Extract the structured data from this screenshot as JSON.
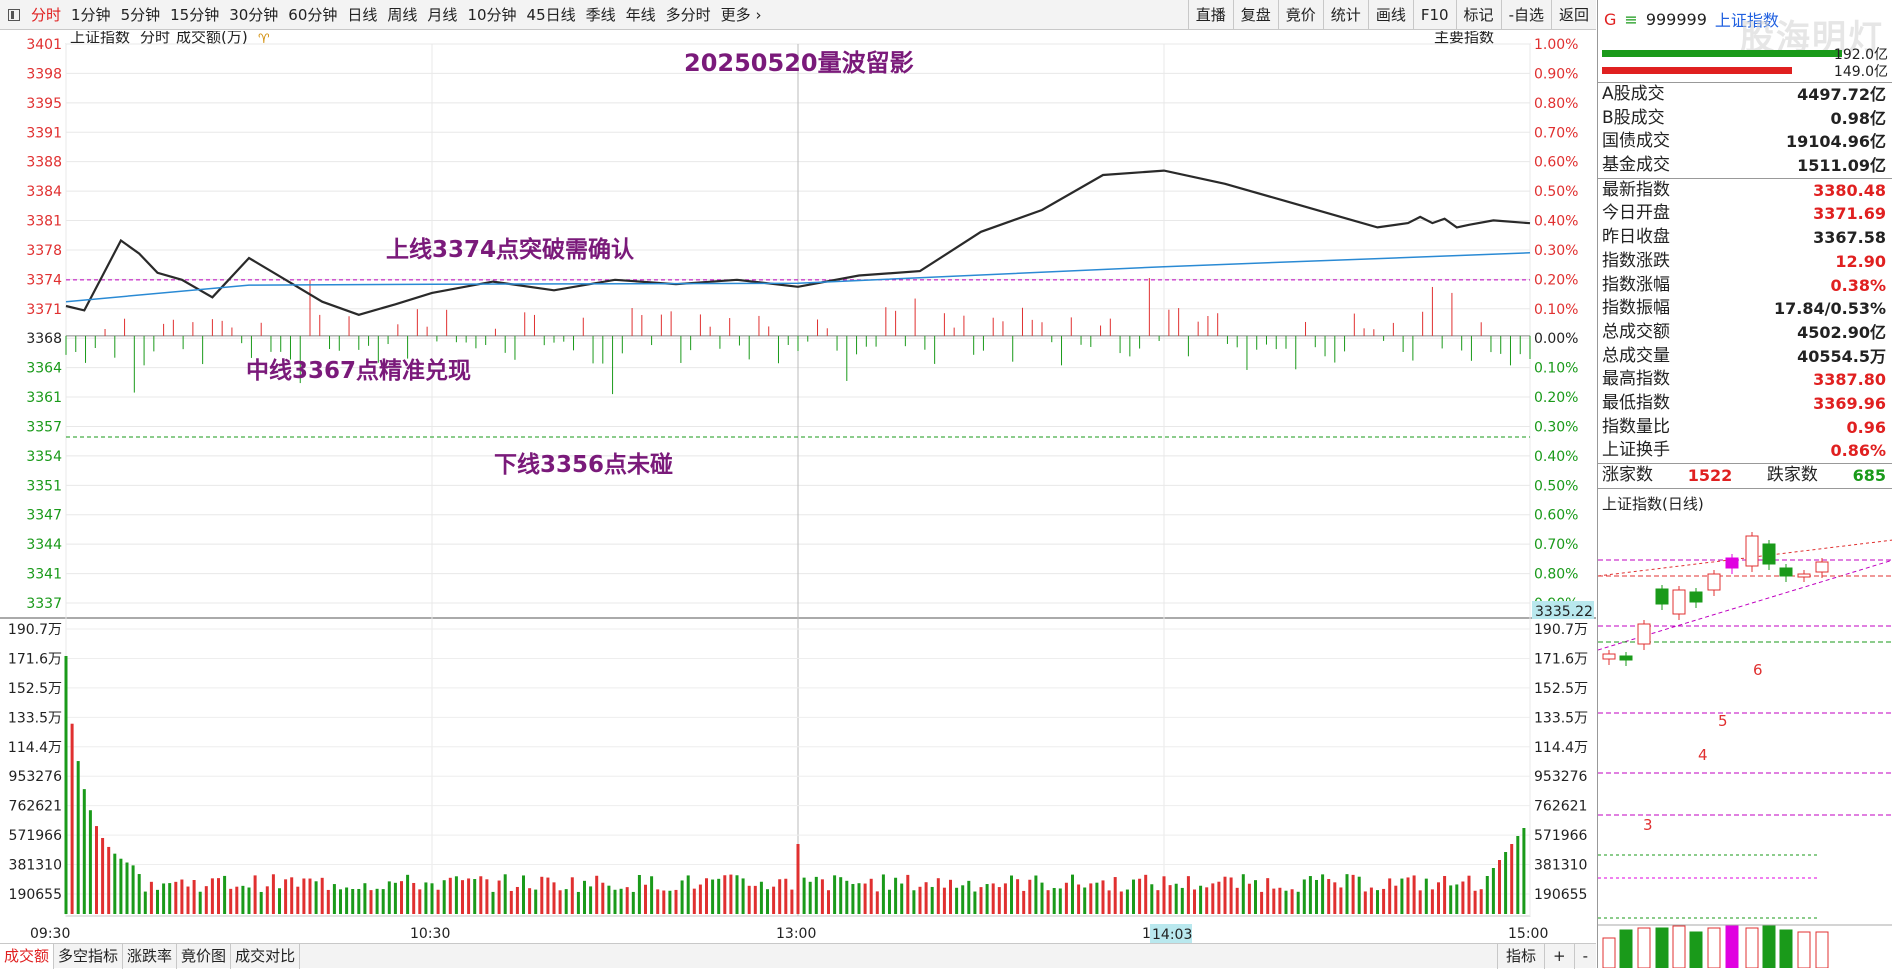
{
  "toolbar": {
    "periods": [
      "分时",
      "1分钟",
      "5分钟",
      "15分钟",
      "30分钟",
      "60分钟",
      "日线",
      "周线",
      "月线",
      "10分钟",
      "45日线",
      "季线",
      "年线",
      "多分时",
      "更多"
    ],
    "right_buttons": [
      "直播",
      "复盘",
      "竟价",
      "统计",
      "画线",
      "F10",
      "标记",
      "-自选",
      "返回"
    ]
  },
  "chart_header": {
    "name": "上证指数",
    "mode": "分时",
    "volume_unit": "成交额(万)",
    "main_index": "主要指数"
  },
  "annotations": {
    "title": "20250520量波留影",
    "upper": "上线3374点突破需确认",
    "middle": "中线3367点精准兑现",
    "lower": "下线3356点未碰"
  },
  "price_axis": {
    "left_ticks": [
      "3401",
      "3398",
      "3395",
      "3391",
      "3388",
      "3384",
      "3381",
      "3378",
      "3374",
      "3371",
      "3368",
      "3364",
      "3361",
      "3357",
      "3354",
      "3351",
      "3347",
      "3344",
      "3341",
      "3337"
    ],
    "right_ticks": [
      "1.00%",
      "0.90%",
      "0.80%",
      "0.70%",
      "0.60%",
      "0.50%",
      "0.40%",
      "0.30%",
      "0.20%",
      "0.10%",
      "0.00%",
      "0.10%",
      "0.20%",
      "0.30%",
      "0.40%",
      "0.50%",
      "0.60%",
      "0.70%",
      "0.80%",
      "0.90%"
    ],
    "cursor_value": "3335.22"
  },
  "volume_axis": {
    "ticks": [
      "190.7万",
      "171.6万",
      "152.5万",
      "133.5万",
      "114.4万",
      "953276",
      "762621",
      "571966",
      "381310",
      "190655"
    ]
  },
  "time_axis": {
    "labels": [
      "09:30",
      "10:30",
      "13:00",
      "14",
      "15:00"
    ],
    "cursor_time": "14:03"
  },
  "bottom_tabs": [
    "成交额",
    "多空指标",
    "涨跌率",
    "竟价图",
    "成交对比"
  ],
  "bottom_right": [
    "指标",
    "+",
    "-"
  ],
  "side": {
    "code_letter": "G",
    "code": "999999",
    "name": "上证指数",
    "watermark": "股海明灯",
    "top_values": [
      "192.0亿",
      "149.0亿"
    ],
    "turnover": [
      {
        "label": "A股成交",
        "value": "4497.72亿"
      },
      {
        "label": "B股成交",
        "value": "0.98亿"
      },
      {
        "label": "国债成交",
        "value": "19104.96亿"
      },
      {
        "label": "基金成交",
        "value": "1511.09亿"
      }
    ],
    "stats": [
      {
        "label": "最新指数",
        "value": "3380.48",
        "color": "red"
      },
      {
        "label": "今日开盘",
        "value": "3371.69",
        "color": "red"
      },
      {
        "label": "昨日收盘",
        "value": "3367.58",
        "color": "dark"
      },
      {
        "label": "指数涨跌",
        "value": "12.90",
        "color": "red"
      },
      {
        "label": "指数涨幅",
        "value": "0.38%",
        "color": "red"
      },
      {
        "label": "指数振幅",
        "value": "17.84/0.53%",
        "color": "dark"
      },
      {
        "label": "总成交额",
        "value": "4502.90亿",
        "color": "dark"
      },
      {
        "label": "总成交量",
        "value": "40554.5万",
        "color": "dark"
      },
      {
        "label": "最高指数",
        "value": "3387.80",
        "color": "red"
      },
      {
        "label": "最低指数",
        "value": "3369.96",
        "color": "red"
      },
      {
        "label": "指数量比",
        "value": "0.96",
        "color": "red"
      },
      {
        "label": "上证换手",
        "value": "0.86%",
        "color": "red"
      }
    ],
    "breadth": {
      "up_label": "涨家数",
      "up": "1522",
      "down_label": "跌家数",
      "down": "685"
    },
    "daily_title": "上证指数(日线)",
    "wave_labels": [
      "3",
      "4",
      "5",
      "6"
    ]
  },
  "colors": {
    "up": "#e03030",
    "down": "#1a9a1a",
    "price": "#2a2a2a",
    "avg": "#2a8ad4",
    "purple": "#800080"
  },
  "chart_data": {
    "type": "line",
    "prev_close": 3367.58,
    "x": [
      "09:30",
      "10:30",
      "13:00",
      "14:00",
      "15:00"
    ],
    "series": [
      {
        "x": [
          0,
          3,
          6,
          9,
          12,
          15,
          19,
          24,
          30,
          36,
          42,
          48,
          54,
          60,
          70,
          80,
          90,
          100,
          110,
          120,
          130,
          140,
          150,
          160,
          170,
          180,
          190,
          200,
          210,
          215,
          220,
          222,
          224,
          226,
          228,
          230,
          234,
          240
        ],
        "values": [
          3371.0,
          3370.5,
          3374.5,
          3378.5,
          3377.0,
          3374.8,
          3374.0,
          3372.0,
          3376.5,
          3374.0,
          3371.5,
          3370.0,
          3371.2,
          3372.5,
          3373.8,
          3372.8,
          3374.0,
          3373.5,
          3374.0,
          3373.2,
          3374.5,
          3375.0,
          3379.5,
          3382.0,
          3386.0,
          3386.5,
          3385.0,
          3383.0,
          3381.0,
          3380.0,
          3380.5,
          3381.2,
          3380.5,
          3381.0,
          3380.0,
          3380.3,
          3380.8,
          3380.48
        ]
      },
      {
        "x": [
          0,
          30,
          60,
          120,
          180,
          240
        ],
        "values": [
          3371.5,
          3373.4,
          3373.5,
          3373.6,
          3375.5,
          3377.1
        ]
      }
    ],
    "ylim": [
      3337,
      3401
    ],
    "reference_lines": [
      3374,
      3356
    ]
  }
}
